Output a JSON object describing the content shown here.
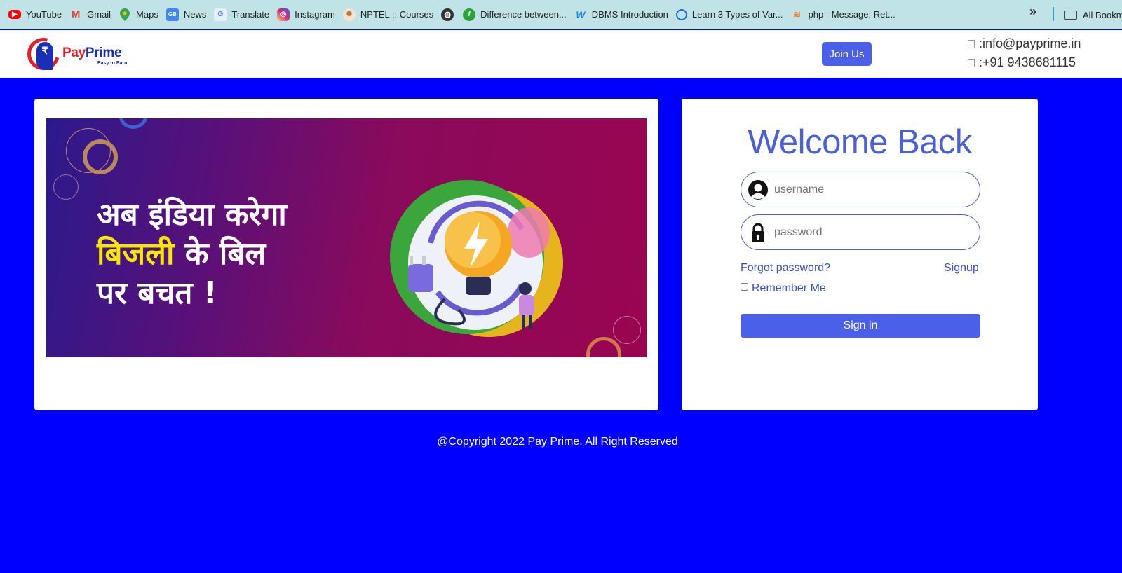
{
  "bookmarks": [
    {
      "label": "YouTube",
      "icon": "youtube-icon",
      "color": "#ff0000"
    },
    {
      "label": "Gmail",
      "icon": "gmail-icon",
      "color": "#ea4335"
    },
    {
      "label": "Maps",
      "icon": "maps-icon",
      "color": "#34a853"
    },
    {
      "label": "News",
      "icon": "news-icon",
      "color": "#4285f4"
    },
    {
      "label": "Translate",
      "icon": "translate-icon",
      "color": "#4285f4"
    },
    {
      "label": "Instagram",
      "icon": "instagram-icon",
      "color": "#d62976"
    },
    {
      "label": "NPTEL :: Courses",
      "icon": "nptel-icon",
      "color": "#c8702a"
    },
    {
      "label": "Difference between...",
      "icon": "globe-icon",
      "color": "#333333"
    },
    {
      "label": "DBMS Introduction",
      "icon": "dbms-icon",
      "color": "#2aa43a"
    },
    {
      "label": "Learn 3 Types of Var...",
      "icon": "w-icon",
      "color": "#1e88e5"
    },
    {
      "label": "php - Message: Ret...",
      "icon": "learn-icon",
      "color": "#1e6fc8"
    }
  ],
  "bookmarks_extra": {
    "more": "»",
    "all": "All Bookmarks"
  },
  "header": {
    "logo_pay": "Pay",
    "logo_prime": "Prime",
    "logo_tagline": "Easy to Earn",
    "join_label": "Join Us",
    "email": ":info@payprime.in",
    "phone": ":+91 9438681115"
  },
  "banner": {
    "line1": "अब इंडिया करेगा",
    "line2_highlight": "बिजली",
    "line2_rest": " के बिल",
    "line3": "पर बचत !"
  },
  "login": {
    "title": "Welcome Back",
    "username_placeholder": "username",
    "password_placeholder": "password",
    "forgot": "Forgot password?",
    "signup": "Signup",
    "remember": "Remember Me",
    "signin": "Sign in"
  },
  "footer": {
    "copyright": "@Copyright 2022 Pay Prime. All Right Reserved"
  },
  "colors": {
    "page_bg": "#0000fe",
    "accent": "#4a60e8",
    "link": "#3b50c8",
    "highlight": "#f6e600"
  }
}
